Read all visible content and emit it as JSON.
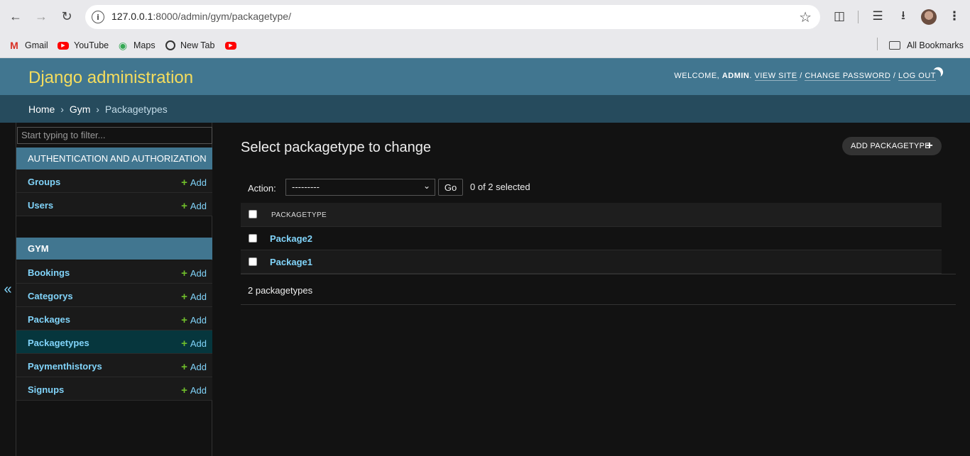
{
  "browser": {
    "url_host": "127.0.0.1",
    "url_path": ":8000/admin/gym/packagetype/",
    "bookmarks": [
      {
        "label": "Gmail",
        "icon": "gmail-icon"
      },
      {
        "label": "YouTube",
        "icon": "youtube-icon"
      },
      {
        "label": "Maps",
        "icon": "maps-icon"
      },
      {
        "label": "New Tab",
        "icon": "chrome-icon"
      },
      {
        "label": "",
        "icon": "youtube-icon"
      }
    ],
    "all_bookmarks_label": "All Bookmarks"
  },
  "header": {
    "site_name": "Django administration",
    "welcome": "Welcome,",
    "username": "admin",
    "view_site": "View site",
    "change_password": "Change password",
    "log_out": "Log out",
    "sep": "/"
  },
  "breadcrumbs": {
    "home": "Home",
    "app": "Gym",
    "current": "Packagetypes",
    "sep": "›"
  },
  "sidebar": {
    "filter_placeholder": "Start typing to filter...",
    "collapse_label": "«",
    "apps": [
      {
        "caption": "Authentication and Authorization",
        "models": [
          {
            "name": "Groups",
            "add": "Add"
          },
          {
            "name": "Users",
            "add": "Add"
          }
        ]
      },
      {
        "caption": "Gym",
        "models": [
          {
            "name": "Bookings",
            "add": "Add"
          },
          {
            "name": "Categorys",
            "add": "Add"
          },
          {
            "name": "Packages",
            "add": "Add"
          },
          {
            "name": "Packagetypes",
            "add": "Add"
          },
          {
            "name": "Paymenthistorys",
            "add": "Add"
          },
          {
            "name": "Signups",
            "add": "Add"
          }
        ]
      }
    ]
  },
  "content": {
    "title": "Select packagetype to change",
    "add_button": "ADD PACKAGETYPE",
    "action_label": "Action:",
    "action_selected": "---------",
    "go_label": "Go",
    "selection_counter": "0 of 2 selected",
    "column_header": "PACKAGETYPE",
    "rows": [
      "Package2",
      "Package1"
    ],
    "result_count": "2 packagetypes"
  },
  "colors": {
    "header_bg": "#417690",
    "site_name": "#f5dd5d",
    "breadcrumbs_bg": "#264b5d",
    "link": "#81d4fa",
    "add_plus": "#70bf2b",
    "selected_row": "#06363d"
  }
}
